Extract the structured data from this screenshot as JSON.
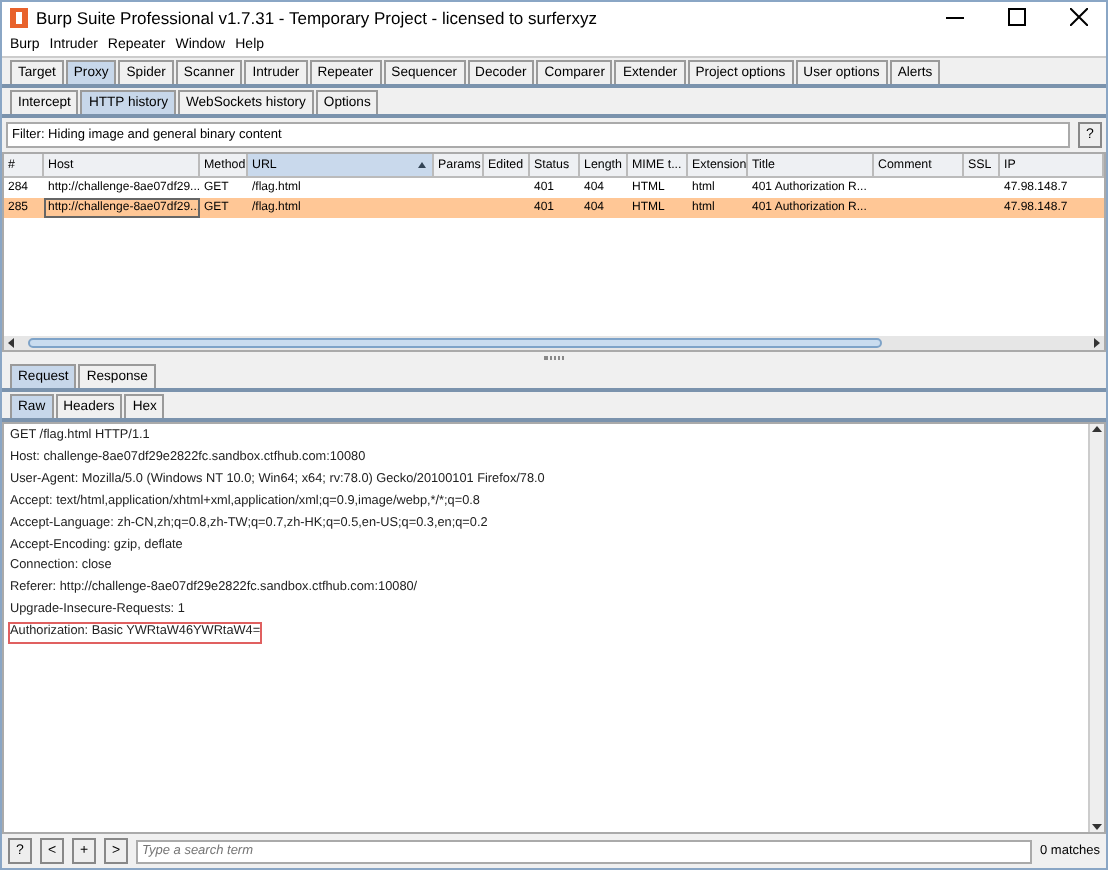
{
  "window": {
    "title": "Burp Suite Professional v1.7.31 - Temporary Project - licensed to surferxyz"
  },
  "menu": [
    "Burp",
    "Intruder",
    "Repeater",
    "Window",
    "Help"
  ],
  "tabs": [
    {
      "label": "Target",
      "selected": false
    },
    {
      "label": "Proxy",
      "selected": true
    },
    {
      "label": "Spider",
      "selected": false
    },
    {
      "label": "Scanner",
      "selected": false
    },
    {
      "label": "Intruder",
      "selected": false
    },
    {
      "label": "Repeater",
      "selected": false
    },
    {
      "label": "Sequencer",
      "selected": false
    },
    {
      "label": "Decoder",
      "selected": false
    },
    {
      "label": "Comparer",
      "selected": false
    },
    {
      "label": "Extender",
      "selected": false
    },
    {
      "label": "Project options",
      "selected": false
    },
    {
      "label": "User options",
      "selected": false
    },
    {
      "label": "Alerts",
      "selected": false
    }
  ],
  "proxy_tabs": [
    {
      "label": "Intercept",
      "selected": false
    },
    {
      "label": "HTTP history",
      "selected": true
    },
    {
      "label": "WebSockets history",
      "selected": false
    },
    {
      "label": "Options",
      "selected": false
    }
  ],
  "filter": {
    "text": "Filter: Hiding image and general binary content",
    "help": "?"
  },
  "table": {
    "columns": [
      {
        "label": "#",
        "sorted": false
      },
      {
        "label": "Host",
        "sorted": false
      },
      {
        "label": "Method",
        "sorted": false
      },
      {
        "label": "URL",
        "sorted": true
      },
      {
        "label": "Params",
        "sorted": false
      },
      {
        "label": "Edited",
        "sorted": false
      },
      {
        "label": "Status",
        "sorted": false
      },
      {
        "label": "Length",
        "sorted": false
      },
      {
        "label": "MIME t...",
        "sorted": false
      },
      {
        "label": "Extension",
        "sorted": false
      },
      {
        "label": "Title",
        "sorted": false
      },
      {
        "label": "Comment",
        "sorted": false
      },
      {
        "label": "SSL",
        "sorted": false
      },
      {
        "label": "IP",
        "sorted": false
      }
    ],
    "rows": [
      {
        "selected": false,
        "cells": [
          "284",
          "http://challenge-8ae07df29...",
          "GET",
          "/flag.html",
          "",
          "",
          "401",
          "404",
          "HTML",
          "html",
          "401 Authorization R...",
          "",
          "",
          "47.98.148.7"
        ]
      },
      {
        "selected": true,
        "cells": [
          "285",
          "http://challenge-8ae07df29...",
          "GET",
          "/flag.html",
          "",
          "",
          "401",
          "404",
          "HTML",
          "html",
          "401 Authorization R...",
          "",
          "",
          "47.98.148.7"
        ]
      }
    ]
  },
  "message_tabs": [
    {
      "label": "Request",
      "selected": true
    },
    {
      "label": "Response",
      "selected": false
    }
  ],
  "view_tabs": [
    {
      "label": "Raw",
      "selected": true
    },
    {
      "label": "Headers",
      "selected": false
    },
    {
      "label": "Hex",
      "selected": false
    }
  ],
  "request_lines": [
    {
      "text": "GET /flag.html HTTP/1.1",
      "highlighted": false
    },
    {
      "text": "Host: challenge-8ae07df29e2822fc.sandbox.ctfhub.com:10080",
      "highlighted": false
    },
    {
      "text": "User-Agent: Mozilla/5.0 (Windows NT 10.0; Win64; x64; rv:78.0) Gecko/20100101 Firefox/78.0",
      "highlighted": false
    },
    {
      "text": "Accept: text/html,application/xhtml+xml,application/xml;q=0.9,image/webp,*/*;q=0.8",
      "highlighted": false
    },
    {
      "text": "Accept-Language: zh-CN,zh;q=0.8,zh-TW;q=0.7,zh-HK;q=0.5,en-US;q=0.3,en;q=0.2",
      "highlighted": false
    },
    {
      "text": "Accept-Encoding: gzip, deflate",
      "highlighted": false
    },
    {
      "text": "Connection: close",
      "highlighted": false
    },
    {
      "text": "Referer: http://challenge-8ae07df29e2822fc.sandbox.ctfhub.com:10080/",
      "highlighted": false
    },
    {
      "text": "Upgrade-Insecure-Requests: 1",
      "highlighted": false
    },
    {
      "text": "Authorization: Basic YWRtaW46YWRtaW4=",
      "highlighted": true
    }
  ],
  "search_bar": {
    "buttons": [
      "?",
      "<",
      "+",
      ">"
    ],
    "placeholder": "Type a search term",
    "matches": "0 matches"
  }
}
